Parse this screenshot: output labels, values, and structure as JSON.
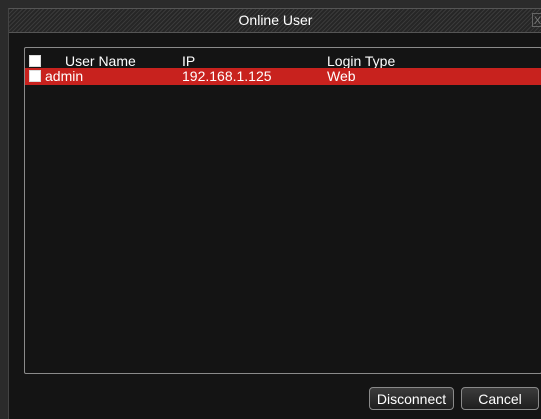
{
  "window": {
    "title": "Online User",
    "close_glyph": "X"
  },
  "table": {
    "headers": {
      "user_name": "User Name",
      "ip": "IP",
      "login_type": "Login Type"
    },
    "rows": [
      {
        "user_name": "admin",
        "ip": "192.168.1.125",
        "login_type": "Web",
        "selected": true
      }
    ]
  },
  "buttons": {
    "disconnect_label": "Disconnect",
    "cancel_label": "Cancel"
  },
  "colors": {
    "selected_row": "#c8221e",
    "background": "#141414"
  },
  "icons": {
    "close": "close-icon"
  }
}
